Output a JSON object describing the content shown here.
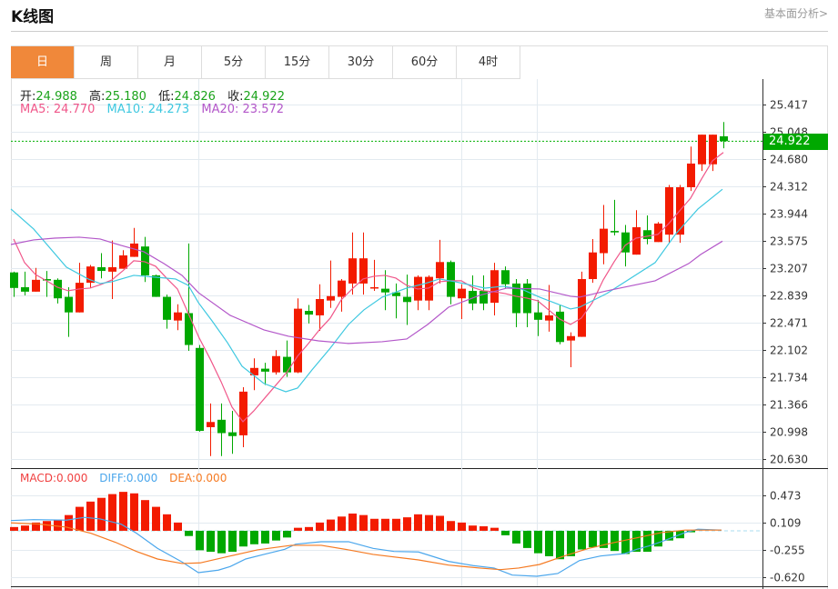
{
  "header": {
    "title": "K线图",
    "fundamental_link": "基本面分析>"
  },
  "tabs": [
    {
      "label": "日",
      "active": true
    },
    {
      "label": "周"
    },
    {
      "label": "月"
    },
    {
      "label": "5分"
    },
    {
      "label": "15分"
    },
    {
      "label": "30分"
    },
    {
      "label": "60分"
    },
    {
      "label": "4时"
    }
  ],
  "ohlc_legend": [
    {
      "label": "开:",
      "value": "24.988"
    },
    {
      "label": "高:",
      "value": "25.180"
    },
    {
      "label": "低:",
      "value": "24.826"
    },
    {
      "label": "收:",
      "value": "24.922"
    }
  ],
  "ma_legend": [
    {
      "label": "MA5:",
      "value": "24.770",
      "color": "#f0578a"
    },
    {
      "label": "MA10:",
      "value": "24.273",
      "color": "#3ec8e0"
    },
    {
      "label": "MA20:",
      "value": "23.572",
      "color": "#b357c9"
    }
  ],
  "macd_legend": [
    {
      "label": "MACD:",
      "value": "0.000",
      "color": "#f04040"
    },
    {
      "label": "DIFF:",
      "value": "0.000",
      "color": "#4aa6ec"
    },
    {
      "label": "DEA:",
      "value": "0.000",
      "color": "#f57a22"
    }
  ],
  "last_price_label": "24.922",
  "colors": {
    "up": "#f31b00",
    "down": "#00a800",
    "grid": "#e3eaf0"
  },
  "chart_data": [
    {
      "type": "candlestick",
      "title": "K线图",
      "y_ticks": [
        "25.417",
        "25.048",
        "24.680",
        "24.312",
        "23.944",
        "23.575",
        "23.207",
        "22.839",
        "22.471",
        "22.102",
        "21.734",
        "21.366",
        "20.998",
        "20.630"
      ],
      "ylim": [
        20.63,
        25.417
      ],
      "last_price": 24.922,
      "candles_ohlc": [
        [
          23.15,
          23.16,
          22.82,
          22.94
        ],
        [
          22.95,
          23.16,
          22.84,
          22.89
        ],
        [
          22.89,
          23.21,
          22.89,
          23.05
        ],
        [
          23.06,
          23.17,
          22.82,
          23.04
        ],
        [
          23.05,
          23.07,
          22.73,
          22.8
        ],
        [
          22.82,
          22.95,
          22.28,
          22.61
        ],
        [
          22.61,
          23.28,
          22.61,
          23.01
        ],
        [
          23.01,
          23.25,
          22.94,
          23.23
        ],
        [
          23.22,
          23.41,
          23.07,
          23.17
        ],
        [
          23.16,
          23.58,
          22.79,
          23.22
        ],
        [
          23.2,
          23.45,
          23.2,
          23.38
        ],
        [
          23.36,
          23.75,
          23.36,
          23.54
        ],
        [
          23.5,
          23.63,
          23.02,
          23.11
        ],
        [
          23.11,
          23.12,
          22.82,
          22.82
        ],
        [
          22.82,
          22.85,
          22.39,
          22.51
        ],
        [
          22.5,
          22.72,
          22.37,
          22.61
        ],
        [
          22.6,
          23.54,
          22.09,
          22.17
        ],
        [
          22.13,
          22.17,
          21.0,
          21.01
        ],
        [
          21.06,
          21.38,
          20.67,
          21.13
        ],
        [
          21.16,
          21.38,
          20.67,
          20.98
        ],
        [
          20.99,
          21.28,
          20.7,
          20.94
        ],
        [
          20.95,
          21.6,
          20.79,
          21.54
        ],
        [
          21.76,
          21.99,
          21.56,
          21.86
        ],
        [
          21.85,
          21.93,
          21.63,
          21.81
        ],
        [
          21.8,
          22.1,
          21.77,
          22.02
        ],
        [
          22.01,
          22.23,
          21.74,
          21.8
        ],
        [
          21.8,
          22.8,
          21.79,
          22.66
        ],
        [
          22.63,
          22.71,
          22.46,
          22.58
        ],
        [
          22.57,
          22.99,
          22.36,
          22.79
        ],
        [
          22.77,
          23.31,
          22.67,
          22.83
        ],
        [
          22.82,
          23.06,
          22.62,
          23.04
        ],
        [
          23.0,
          23.69,
          22.85,
          23.34
        ],
        [
          23.0,
          23.69,
          22.85,
          23.34
        ],
        [
          22.94,
          23.32,
          22.9,
          22.95
        ],
        [
          22.93,
          23.18,
          22.64,
          22.88
        ],
        [
          22.88,
          23.0,
          22.53,
          22.83
        ],
        [
          22.82,
          23.12,
          22.44,
          22.75
        ],
        [
          22.77,
          23.11,
          22.64,
          23.09
        ],
        [
          22.77,
          23.11,
          22.64,
          23.09
        ],
        [
          23.07,
          23.59,
          23.0,
          23.29
        ],
        [
          23.29,
          23.31,
          22.72,
          22.82
        ],
        [
          22.8,
          22.99,
          22.52,
          22.93
        ],
        [
          22.9,
          23.11,
          22.64,
          22.73
        ],
        [
          22.9,
          23.11,
          22.64,
          22.73
        ],
        [
          22.74,
          23.28,
          22.57,
          23.18
        ],
        [
          23.18,
          23.23,
          22.94,
          22.99
        ],
        [
          23.0,
          23.06,
          22.41,
          22.6
        ],
        [
          23.0,
          23.06,
          22.41,
          22.6
        ],
        [
          22.61,
          22.78,
          22.29,
          22.51
        ],
        [
          22.5,
          22.98,
          22.35,
          22.57
        ],
        [
          22.62,
          22.71,
          22.18,
          22.21
        ],
        [
          22.23,
          22.34,
          21.87,
          22.29
        ],
        [
          22.28,
          23.16,
          22.28,
          23.06
        ],
        [
          23.06,
          23.6,
          23.01,
          23.42
        ],
        [
          23.41,
          24.06,
          23.26,
          23.74
        ],
        [
          23.71,
          24.13,
          23.65,
          23.69
        ],
        [
          23.69,
          23.79,
          23.23,
          23.42
        ],
        [
          23.39,
          23.99,
          23.39,
          23.76
        ],
        [
          23.72,
          23.92,
          23.53,
          23.6
        ],
        [
          23.56,
          23.83,
          23.56,
          23.81
        ],
        [
          23.66,
          24.33,
          23.55,
          24.3
        ],
        [
          23.66,
          24.33,
          23.55,
          24.3
        ],
        [
          24.3,
          24.85,
          24.25,
          24.62
        ],
        [
          24.61,
          25.01,
          24.52,
          25.01
        ],
        [
          24.61,
          25.01,
          24.52,
          25.01
        ],
        [
          24.988,
          25.18,
          24.826,
          24.922
        ]
      ],
      "ma5": [
        23.601,
        23.282,
        23.122,
        23.037,
        22.951,
        22.902,
        22.926,
        22.938,
        22.987,
        23.049,
        23.172,
        23.307,
        23.294,
        23.233,
        23.073,
        22.926,
        22.595,
        22.263,
        21.981,
        21.674,
        21.331,
        21.134,
        21.281,
        21.453,
        21.625,
        21.797,
        22.018,
        22.19,
        22.374,
        22.533,
        22.779,
        22.926,
        23.061,
        23.098,
        23.11,
        23.073,
        22.975,
        22.926,
        22.938,
        23.024,
        23.037,
        23.037,
        22.951,
        22.902,
        22.889,
        22.865,
        22.828,
        22.803,
        22.766,
        22.644,
        22.521,
        22.447,
        22.533,
        22.742,
        23.049,
        23.294,
        23.515,
        23.613,
        23.638,
        23.663,
        23.81,
        23.982,
        24.153,
        24.411,
        24.657,
        24.77
      ],
      "ma10_points": [
        [
          -0.25,
          24.006
        ],
        [
          1.83,
          23.736
        ],
        [
          4.83,
          23.221
        ],
        [
          6.83,
          23.061
        ],
        [
          7.92,
          23.0
        ],
        [
          9,
          23.024
        ],
        [
          11,
          23.11
        ],
        [
          12.92,
          23.086
        ],
        [
          14.83,
          23.061
        ],
        [
          16,
          22.975
        ],
        [
          16.92,
          22.742
        ],
        [
          18.17,
          22.496
        ],
        [
          19.58,
          22.202
        ],
        [
          20.92,
          21.883
        ],
        [
          22.92,
          21.65
        ],
        [
          24.92,
          21.539
        ],
        [
          26,
          21.588
        ],
        [
          27.33,
          21.834
        ],
        [
          29,
          22.128
        ],
        [
          30.67,
          22.447
        ],
        [
          32.08,
          22.644
        ],
        [
          33.75,
          22.816
        ],
        [
          36,
          22.938
        ],
        [
          37.67,
          23.0
        ],
        [
          39,
          23.061
        ],
        [
          40.42,
          23.024
        ],
        [
          43.17,
          22.938
        ],
        [
          44.83,
          22.963
        ],
        [
          46.5,
          22.926
        ],
        [
          48.17,
          22.816
        ],
        [
          51,
          22.656
        ],
        [
          51.83,
          22.68
        ],
        [
          54.33,
          22.865
        ],
        [
          58.75,
          23.282
        ],
        [
          60.67,
          23.675
        ],
        [
          62.67,
          24.006
        ],
        [
          64.92,
          24.273
        ]
      ],
      "ma20_points": [
        [
          -0.25,
          23.527
        ],
        [
          1.83,
          23.589
        ],
        [
          3.75,
          23.613
        ],
        [
          6,
          23.626
        ],
        [
          7.92,
          23.601
        ],
        [
          9.83,
          23.515
        ],
        [
          11.92,
          23.429
        ],
        [
          13.75,
          23.27
        ],
        [
          15.42,
          23.11
        ],
        [
          16.92,
          22.877
        ],
        [
          19.83,
          22.57
        ],
        [
          22.92,
          22.374
        ],
        [
          25.17,
          22.288
        ],
        [
          27.92,
          22.226
        ],
        [
          30.67,
          22.19
        ],
        [
          33.75,
          22.214
        ],
        [
          36,
          22.251
        ],
        [
          37.92,
          22.447
        ],
        [
          39.83,
          22.68
        ],
        [
          42.67,
          22.84
        ],
        [
          45.17,
          22.938
        ],
        [
          48.17,
          22.926
        ],
        [
          51,
          22.828
        ],
        [
          51.83,
          22.816
        ],
        [
          54.33,
          22.902
        ],
        [
          58.75,
          23.037
        ],
        [
          61.83,
          23.27
        ],
        [
          62.92,
          23.392
        ],
        [
          64.92,
          23.572
        ]
      ]
    },
    {
      "type": "bar",
      "title": "MACD",
      "y_ticks": [
        "0.473",
        "0.109",
        "-0.255",
        "-0.620"
      ],
      "ylim": [
        -0.62,
        0.473
      ],
      "macd_hist": [
        0.05,
        0.07,
        0.11,
        0.13,
        0.15,
        0.21,
        0.32,
        0.39,
        0.44,
        0.49,
        0.52,
        0.5,
        0.41,
        0.32,
        0.22,
        0.11,
        -0.07,
        -0.26,
        -0.28,
        -0.3,
        -0.28,
        -0.21,
        -0.18,
        -0.17,
        -0.13,
        -0.09,
        0.04,
        0.05,
        0.11,
        0.15,
        0.19,
        0.23,
        0.21,
        0.16,
        0.16,
        0.16,
        0.18,
        0.22,
        0.21,
        0.2,
        0.13,
        0.11,
        0.07,
        0.06,
        0.04,
        -0.06,
        -0.17,
        -0.23,
        -0.3,
        -0.34,
        -0.38,
        -0.34,
        -0.25,
        -0.22,
        -0.23,
        -0.27,
        -0.31,
        -0.28,
        -0.28,
        -0.21,
        -0.13,
        -0.1,
        -0.02,
        0.0,
        0.0,
        0.0
      ],
      "diff_points": [
        [
          -0.25,
          0.137
        ],
        [
          1.83,
          0.149
        ],
        [
          4.83,
          0.142
        ],
        [
          6.5,
          0.179
        ],
        [
          7.92,
          0.158
        ],
        [
          9.83,
          0.089
        ],
        [
          11.25,
          -0.033
        ],
        [
          13.17,
          -0.235
        ],
        [
          15.42,
          -0.417
        ],
        [
          16.92,
          -0.559
        ],
        [
          18.75,
          -0.526
        ],
        [
          19.83,
          -0.478
        ],
        [
          21.25,
          -0.377
        ],
        [
          22.92,
          -0.316
        ],
        [
          24.83,
          -0.247
        ],
        [
          25.83,
          -0.179
        ],
        [
          28.17,
          -0.146
        ],
        [
          30.67,
          -0.146
        ],
        [
          32.92,
          -0.235
        ],
        [
          34.83,
          -0.276
        ],
        [
          37.08,
          -0.283
        ],
        [
          39.83,
          -0.409
        ],
        [
          42.08,
          -0.465
        ],
        [
          44,
          -0.498
        ],
        [
          45.67,
          -0.592
        ],
        [
          47.92,
          -0.608
        ],
        [
          49.83,
          -0.571
        ],
        [
          51.83,
          -0.397
        ],
        [
          53.75,
          -0.337
        ],
        [
          56,
          -0.304
        ],
        [
          57.08,
          -0.247
        ],
        [
          58.17,
          -0.203
        ],
        [
          59.33,
          -0.146
        ],
        [
          61.5,
          -0.024
        ],
        [
          62.67,
          0.021
        ],
        [
          64.83,
          0.009
        ]
      ],
      "dea_points": [
        [
          -0.25,
          0.106
        ],
        [
          2.33,
          0.089
        ],
        [
          4.83,
          0.049
        ],
        [
          7.08,
          -0.033
        ],
        [
          9.33,
          -0.154
        ],
        [
          11.25,
          -0.276
        ],
        [
          13.17,
          -0.377
        ],
        [
          15.42,
          -0.437
        ],
        [
          17.08,
          -0.429
        ],
        [
          19.83,
          -0.337
        ],
        [
          22.33,
          -0.255
        ],
        [
          25.42,
          -0.194
        ],
        [
          28.17,
          -0.194
        ],
        [
          30.67,
          -0.255
        ],
        [
          32.92,
          -0.316
        ],
        [
          37.08,
          -0.389
        ],
        [
          39.83,
          -0.458
        ],
        [
          42.67,
          -0.498
        ],
        [
          44.58,
          -0.519
        ],
        [
          46.25,
          -0.498
        ],
        [
          48.17,
          -0.45
        ],
        [
          50.42,
          -0.337
        ],
        [
          52.67,
          -0.235
        ],
        [
          54.83,
          -0.162
        ],
        [
          57.08,
          -0.094
        ],
        [
          59.33,
          -0.024
        ],
        [
          61.5,
          0.009
        ],
        [
          64.83,
          0.009
        ]
      ]
    }
  ]
}
